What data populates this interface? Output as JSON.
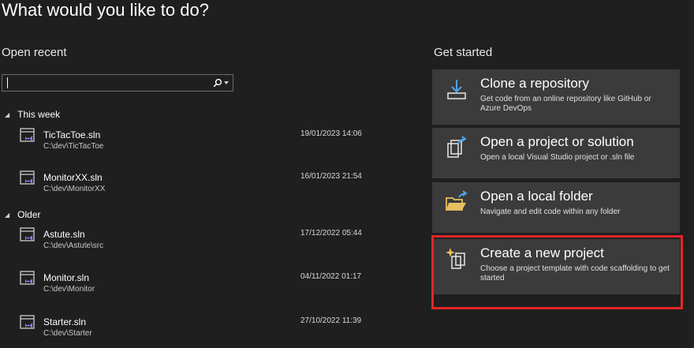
{
  "page": {
    "title": "What would you like to do?"
  },
  "open_recent": {
    "heading": "Open recent",
    "search": {
      "value": "",
      "placeholder": ""
    },
    "groups": [
      {
        "label": "This week",
        "items": [
          {
            "name": "TicTacToe.sln",
            "path": "C:\\dev\\TicTacToe",
            "date": "19/01/2023 14:06"
          },
          {
            "name": "MonitorXX.sln",
            "path": "C:\\dev\\MonitorXX",
            "date": "16/01/2023 21:54"
          }
        ]
      },
      {
        "label": "Older",
        "items": [
          {
            "name": "Astute.sln",
            "path": "C:\\dev\\Astute\\src",
            "date": "17/12/2022 05:44"
          },
          {
            "name": "Monitor.sln",
            "path": "C:\\dev\\Monitor",
            "date": "04/11/2022 01:17"
          },
          {
            "name": "Starter.sln",
            "path": "C:\\dev\\Starter",
            "date": "27/10/2022 11:39"
          }
        ]
      }
    ]
  },
  "get_started": {
    "heading": "Get started",
    "cards": [
      {
        "icon": "clone-repository-icon",
        "title": "Clone a repository",
        "description": "Get code from an online repository like GitHub or Azure DevOps"
      },
      {
        "icon": "open-project-icon",
        "title": "Open a project or solution",
        "description": "Open a local Visual Studio project or .sln file"
      },
      {
        "icon": "open-folder-icon",
        "title": "Open a local folder",
        "description": "Navigate and edit code within any folder"
      },
      {
        "icon": "new-project-icon",
        "title": "Create a new project",
        "description": "Choose a project template with code scaffolding to get started"
      }
    ]
  },
  "colors": {
    "background": "#1f1f1f",
    "card": "#3b3b3b",
    "accent_blue": "#4fa3e8",
    "vs_purple": "#9b7be0",
    "folder_yellow": "#e8c060",
    "highlight_red": "#e3262a"
  }
}
